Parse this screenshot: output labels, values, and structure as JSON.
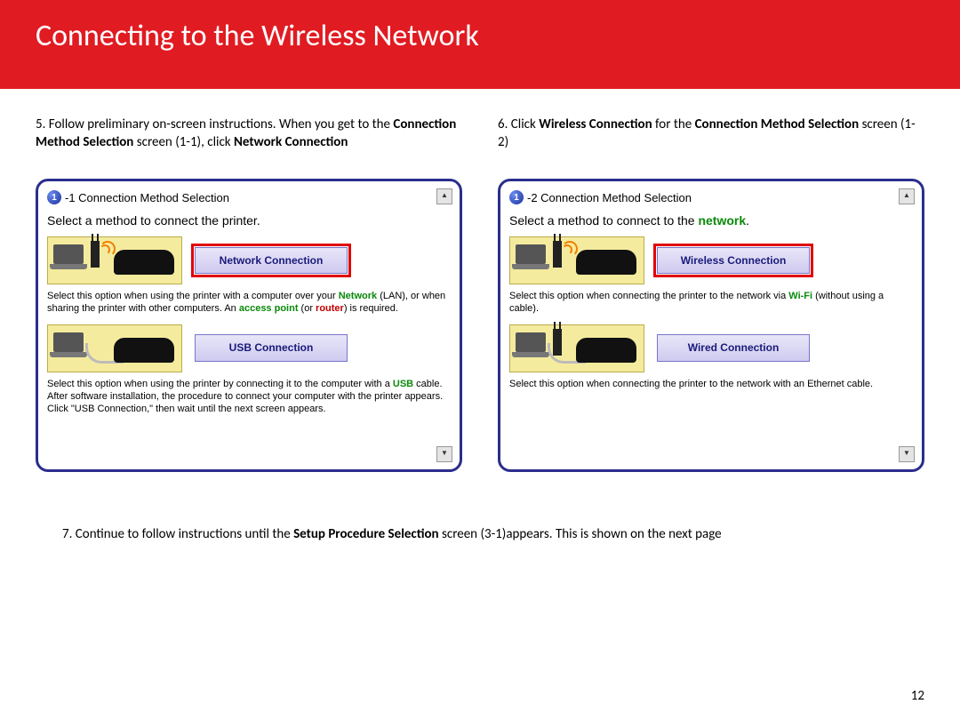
{
  "header": {
    "title": "Connecting to the Wireless Network"
  },
  "instr5": {
    "num": "5.",
    "part1": " Follow preliminary on-screen instructions.  When you get to the ",
    "bold1": "Connection Method Selection",
    "part2": " screen (1-1), click ",
    "bold2": "Network Connection"
  },
  "instr6": {
    "num": "6.",
    "part1": " Click ",
    "bold1": "Wireless Connection",
    "part2": "  for the ",
    "bold2": "Connection Method Selection",
    "part3": " screen (1-2)"
  },
  "dlg1": {
    "step_badge": "1",
    "step_suffix": "-1 Connection Method Selection",
    "prompt": "Select a method to connect the printer.",
    "opt1": {
      "button": "Network Connection",
      "desc_a": "Select this option when using the printer with a computer over your ",
      "desc_net": "Network",
      "desc_b": " (LAN), or when sharing the printer with other computers. An ",
      "desc_ap": "access point",
      "desc_c": " (or ",
      "desc_router": "router",
      "desc_d": ") is required."
    },
    "opt2": {
      "button": "USB Connection",
      "desc_a": "Select this option when using the printer by connecting it to the computer with a ",
      "desc_usb": "USB",
      "desc_b": " cable. After software installation, the procedure to connect your computer with the printer appears. Click \"USB Connection,\" then wait until the next screen appears."
    }
  },
  "dlg2": {
    "step_badge": "1",
    "step_suffix": "-2 Connection Method Selection",
    "prompt_a": "Select a method to connect to the ",
    "prompt_net": "network",
    "prompt_b": ".",
    "opt1": {
      "button": "Wireless Connection",
      "desc_a": "Select this option when connecting the printer to the network via ",
      "desc_wifi": "Wi-Fi",
      "desc_b": " (without using a cable)."
    },
    "opt2": {
      "button": "Wired Connection",
      "desc": "Select this option when connecting the printer to the network with an Ethernet cable."
    }
  },
  "instr7": {
    "num": "7.",
    "part1": "   Continue to follow instructions until the ",
    "bold1": "Setup Procedure Selection",
    "part2": " screen (3-1)appears.  This is shown on the next page"
  },
  "page_number": "12"
}
